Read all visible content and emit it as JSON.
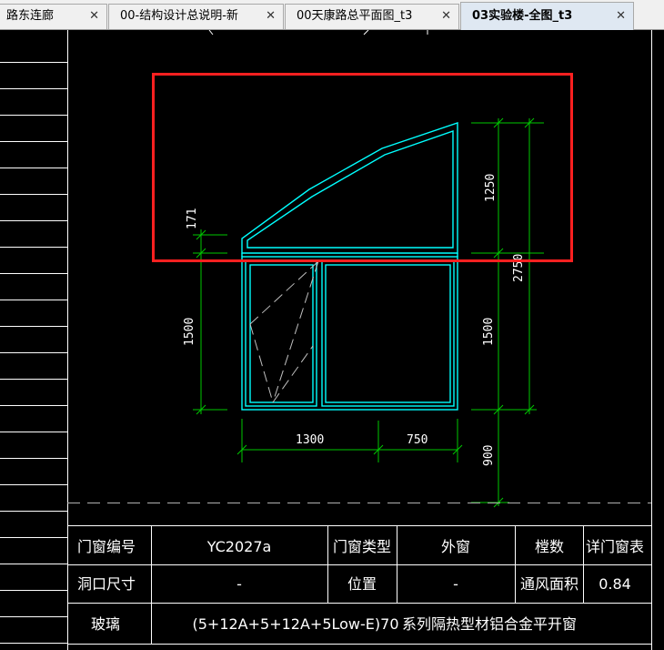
{
  "tabs": [
    {
      "label": "路东连廊",
      "active": false
    },
    {
      "label": "00-结构设计总说明-新",
      "active": false
    },
    {
      "label": "00天康路总平面图_t3",
      "active": false
    },
    {
      "label": "03实验楼-全图_t3",
      "active": true
    }
  ],
  "close_glyph": "✕",
  "dimensions": {
    "d171": "171",
    "d1250": "1250",
    "d2750": "2750",
    "d1500_left": "1500",
    "d1500_right": "1500",
    "d1300": "1300",
    "d750": "750",
    "d900": "900"
  },
  "table": {
    "row1": {
      "label1": "门窗编号",
      "value1": "YC2027a",
      "label2": "门窗类型",
      "value2": "外窗",
      "label3": "樘数",
      "value3": "详门窗表"
    },
    "row2": {
      "label1": "洞口尺寸",
      "value1": "-",
      "label2": "位置",
      "value2": "-",
      "label3": "通风面积",
      "value3": "0.84"
    },
    "row3": {
      "label1": "玻璃",
      "value1": "(5+12A+5+12A+5Low-E)70",
      "value2": "系列隔热型材铝合金平开窗"
    }
  },
  "colors": {
    "frame": "#00ffff",
    "dimension": "#00c800",
    "highlight": "#ff2020",
    "table_line": "#ffffff"
  }
}
